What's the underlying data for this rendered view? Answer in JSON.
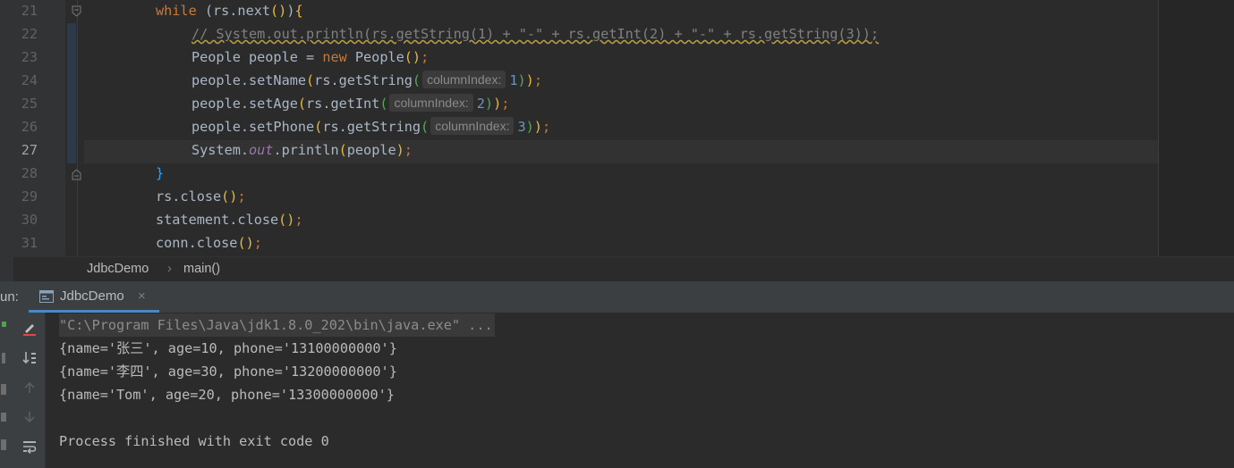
{
  "editor": {
    "lines": [
      {
        "num": "21",
        "tokens": [
          {
            "t": "while",
            "c": "kw"
          },
          {
            "t": " (rs.next",
            "c": ""
          },
          {
            "t": "()",
            "c": "p1"
          },
          {
            "t": ")",
            "c": ""
          },
          {
            "t": "{",
            "c": "p1"
          }
        ]
      },
      {
        "num": "22",
        "tokens": [
          {
            "t": "// System.out.println(rs.getString(1) + \"-\" + rs.getInt(2) + \"-\" + rs.getString(3));",
            "c": "cmt"
          }
        ]
      },
      {
        "num": "23",
        "tokens": [
          {
            "t": "People people = ",
            "c": ""
          },
          {
            "t": "new",
            "c": "kw"
          },
          {
            "t": " People",
            "c": ""
          },
          {
            "t": "()",
            "c": "p1"
          },
          {
            "t": ";",
            "c": "kw"
          }
        ]
      },
      {
        "num": "24",
        "tokens": [
          {
            "t": "people.setName",
            "c": ""
          },
          {
            "t": "(",
            "c": "p1"
          },
          {
            "t": "rs.getString",
            "c": ""
          },
          {
            "t": "(",
            "c": "p2"
          },
          {
            "hint": "columnIndex:"
          },
          {
            "t": "1",
            "c": "num"
          },
          {
            "t": ")",
            "c": "p2"
          },
          {
            "t": ")",
            "c": "p1"
          },
          {
            "t": ";",
            "c": "kw"
          }
        ]
      },
      {
        "num": "25",
        "tokens": [
          {
            "t": "people.setAge",
            "c": ""
          },
          {
            "t": "(",
            "c": "p1"
          },
          {
            "t": "rs.getInt",
            "c": ""
          },
          {
            "t": "(",
            "c": "p2"
          },
          {
            "hint": "columnIndex:"
          },
          {
            "t": "2",
            "c": "num"
          },
          {
            "t": ")",
            "c": "p2"
          },
          {
            "t": ")",
            "c": "p1"
          },
          {
            "t": ";",
            "c": "kw"
          }
        ]
      },
      {
        "num": "26",
        "tokens": [
          {
            "t": "people.setPhone",
            "c": ""
          },
          {
            "t": "(",
            "c": "p1"
          },
          {
            "t": "rs.getString",
            "c": ""
          },
          {
            "t": "(",
            "c": "p2"
          },
          {
            "hint": "columnIndex:"
          },
          {
            "t": "3",
            "c": "num"
          },
          {
            "t": ")",
            "c": "p2"
          },
          {
            "t": ")",
            "c": "p1"
          },
          {
            "t": ";",
            "c": "kw"
          }
        ]
      },
      {
        "num": "27",
        "tokens": [
          {
            "t": "System.",
            "c": ""
          },
          {
            "t": "out",
            "c": "fld"
          },
          {
            "t": ".println",
            "c": ""
          },
          {
            "t": "(",
            "c": "p1"
          },
          {
            "t": "people",
            "c": ""
          },
          {
            "t": ")",
            "c": "p1"
          },
          {
            "t": ";",
            "c": "kw"
          }
        ]
      },
      {
        "num": "28",
        "tokens": [
          {
            "t": "}",
            "c": "p3"
          }
        ]
      },
      {
        "num": "29",
        "tokens": [
          {
            "t": "rs.close",
            "c": ""
          },
          {
            "t": "()",
            "c": "p1"
          },
          {
            "t": ";",
            "c": "kw"
          }
        ]
      },
      {
        "num": "30",
        "tokens": [
          {
            "t": "statement.close",
            "c": ""
          },
          {
            "t": "()",
            "c": "p1"
          },
          {
            "t": ";",
            "c": "kw"
          }
        ]
      },
      {
        "num": "31",
        "tokens": [
          {
            "t": "conn.close",
            "c": ""
          },
          {
            "t": "()",
            "c": "p1"
          },
          {
            "t": ";",
            "c": "kw"
          }
        ]
      }
    ]
  },
  "breadcrumb": {
    "class_name": "JdbcDemo",
    "separator": "›",
    "method_name": "main()"
  },
  "run_panel": {
    "label": "un:",
    "tab_label": "JdbcDemo",
    "tab_close": "×"
  },
  "console": {
    "lines": [
      "\"C:\\Program Files\\Java\\jdk1.8.0_202\\bin\\java.exe\" ...",
      "{name='张三', age=10, phone='13100000000'}",
      "{name='李四', age=30, phone='13200000000'}",
      "{name='Tom', age=20, phone='13300000000'}",
      "",
      "Process finished with exit code 0"
    ]
  },
  "colors": {
    "accent": "#4a88c7",
    "background": "#2b2b2b",
    "panel": "#3c3f41"
  }
}
